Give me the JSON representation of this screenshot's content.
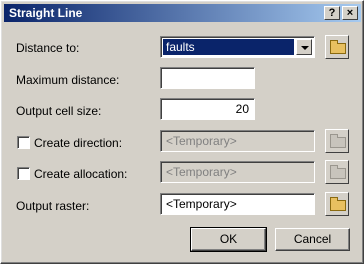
{
  "window": {
    "title": "Straight Line",
    "help_label": "?",
    "close_label": "×"
  },
  "rows": {
    "distance_to": {
      "label": "Distance to:",
      "value": "faults"
    },
    "max_distance": {
      "label": "Maximum distance:",
      "value": ""
    },
    "cell_size": {
      "label": "Output cell size:",
      "value": "20"
    },
    "direction": {
      "label": "Create direction:",
      "value": "<Temporary>",
      "checked": false
    },
    "allocation": {
      "label": "Create allocation:",
      "value": "<Temporary>",
      "checked": false
    },
    "output_raster": {
      "label": "Output raster:",
      "value": "<Temporary>"
    }
  },
  "buttons": {
    "ok": "OK",
    "cancel": "Cancel"
  },
  "icons": {
    "folder": "folder-open-icon",
    "dropdown": "chevron-down-icon"
  }
}
